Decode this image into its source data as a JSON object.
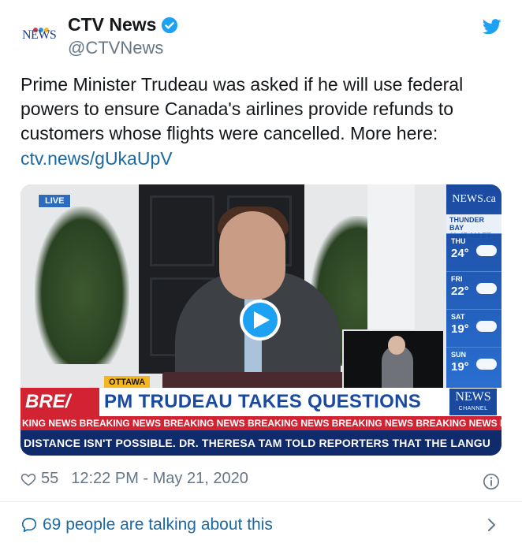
{
  "author": {
    "name": "CTV News",
    "handle": "@CTVNews",
    "avatar_text": "NEWS",
    "verified": true
  },
  "tweet": {
    "text": "Prime Minister Trudeau was asked if he will use federal powers to ensure Canada's airlines provide refunds to customers whose flights were cancelled. More here:",
    "link": "ctv.news/gUkaUpV"
  },
  "video": {
    "live_label": "LIVE",
    "location_tag": "OTTAWA",
    "breaking_label": "BRE/",
    "headline": "PM TRUDEAU TAKES QUESTIONS",
    "channel_logo": "NEWS",
    "channel_logo_sub": "CHANNEL",
    "ticker": "KING NEWS  BREAKING NEWS  BREAKING NEWS  BREAKING NEWS  BREAKING NEWS  BREAKING NEWS  BREAKING NEWS",
    "crawl": "DISTANCE ISN'T POSSIBLE. DR. THERESA TAM TOLD REPORTERS THAT THE LANGU",
    "weather": {
      "logo": "NEWS.ca",
      "city": "THUNDER BAY",
      "time": "11:47 AM ET",
      "days": [
        {
          "day": "THU",
          "temp": "24°"
        },
        {
          "day": "FRI",
          "temp": "22°"
        },
        {
          "day": "SAT",
          "temp": "19°"
        },
        {
          "day": "SUN",
          "temp": "19°"
        }
      ]
    }
  },
  "footer": {
    "likes": "55",
    "timestamp": "12:22 PM - May 21, 2020",
    "talking": "69 people are talking about this"
  },
  "colors": {
    "link_blue": "#1b6aa6",
    "twitter_blue": "#1da1f2",
    "breaking_red": "#d22333",
    "ctv_blue": "#1a4a9f"
  }
}
